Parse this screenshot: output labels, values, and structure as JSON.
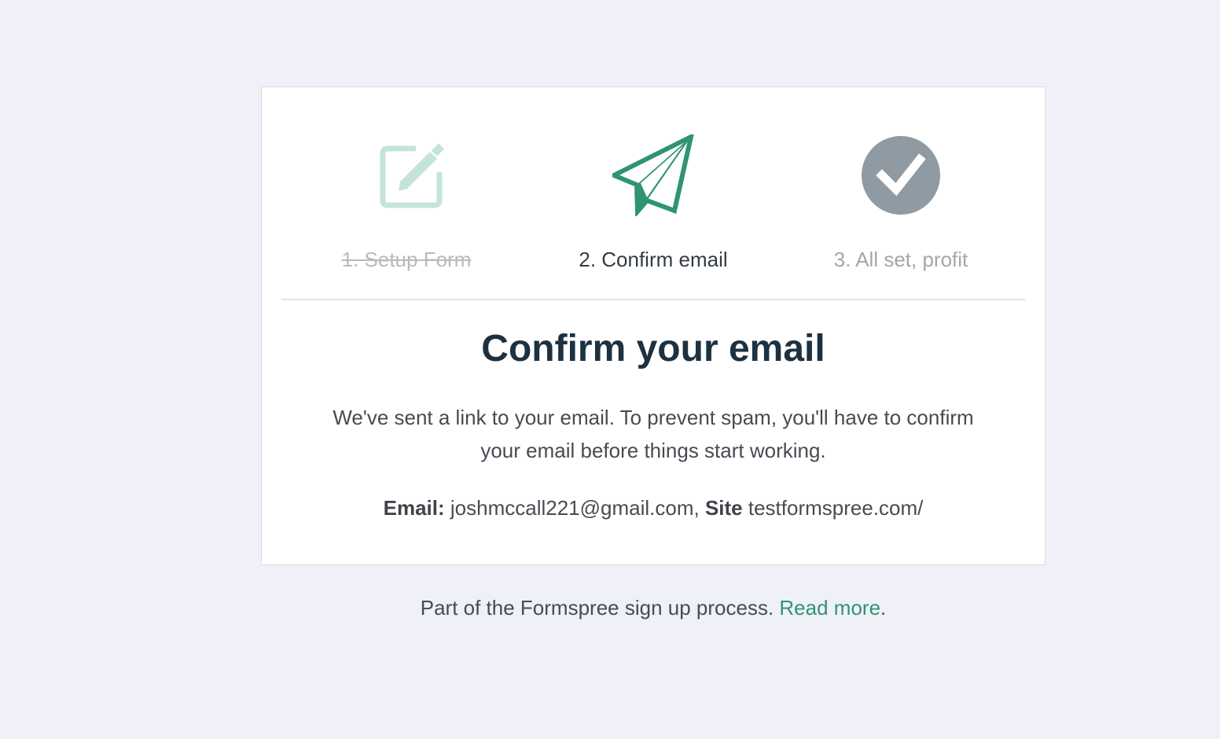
{
  "steps": [
    {
      "label": "1. Setup Form",
      "status": "done",
      "icon": "edit-icon"
    },
    {
      "label": "2. Confirm email",
      "status": "active",
      "icon": "paper-plane-icon"
    },
    {
      "label": "3. All set, profit",
      "status": "pending",
      "icon": "check-circle-icon"
    }
  ],
  "main": {
    "title": "Confirm your email",
    "message": "We've sent a link to your email. To prevent spam, you'll have to confirm your email before things start working.",
    "email_label": "Email:",
    "email_value": "joshmccall221@gmail.com,",
    "site_label": "Site",
    "site_value": "testformspree.com/"
  },
  "footer": {
    "text": "Part of the Formspree sign up process.",
    "link_label": "Read more",
    "suffix": "."
  },
  "colors": {
    "background": "#f0f1f8",
    "accent_green": "#2f9471",
    "done_icon": "#c5e4d9",
    "pending_icon": "#8f9aa2",
    "title": "#1d3140"
  }
}
